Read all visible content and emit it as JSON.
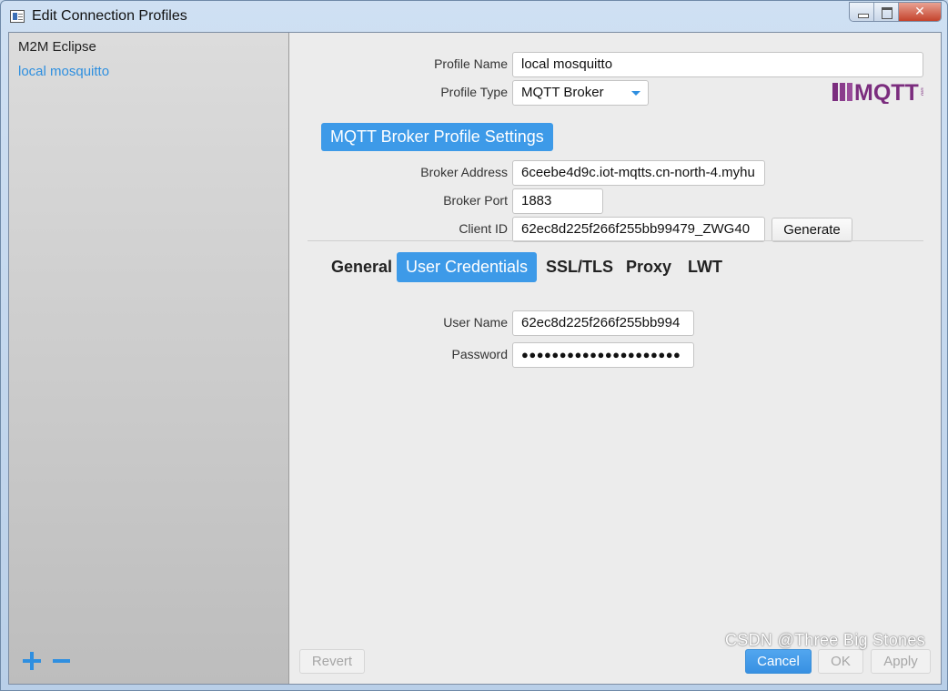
{
  "window": {
    "title": "Edit Connection Profiles",
    "close_glyph": "✕"
  },
  "sidebar": {
    "profiles": [
      {
        "label": "M2M Eclipse"
      },
      {
        "label": "local mosquitto"
      }
    ]
  },
  "profile": {
    "name_label": "Profile Name",
    "name_value": "local mosquitto",
    "type_label": "Profile Type",
    "type_value": "MQTT Broker",
    "logo_text": "MQTT",
    "logo_subtext": "org"
  },
  "broker_settings": {
    "section_title": "MQTT Broker Profile Settings",
    "address_label": "Broker Address",
    "address_value": "6ceebe4d9c.iot-mqtts.cn-north-4.myhu",
    "port_label": "Broker Port",
    "port_value": "1883",
    "client_id_label": "Client ID",
    "client_id_value": "62ec8d225f266f255bb99479_ZWG40",
    "generate_label": "Generate"
  },
  "tabs": [
    {
      "label": "General"
    },
    {
      "label": "User Credentials"
    },
    {
      "label": "SSL/TLS"
    },
    {
      "label": "Proxy"
    },
    {
      "label": "LWT"
    }
  ],
  "credentials": {
    "username_label": "User Name",
    "username_value": "62ec8d225f266f255bb994",
    "password_label": "Password",
    "password_value": "●●●●●●●●●●●●●●●●●●●●●"
  },
  "footer": {
    "revert_label": "Revert",
    "cancel_label": "Cancel",
    "ok_label": "OK",
    "apply_label": "Apply"
  },
  "watermark": "CSDN @Three Big Stones",
  "colors": {
    "accent": "#3d9ae8",
    "selected_profile": "#2e8fdf",
    "logo": "#7b2d7e"
  }
}
